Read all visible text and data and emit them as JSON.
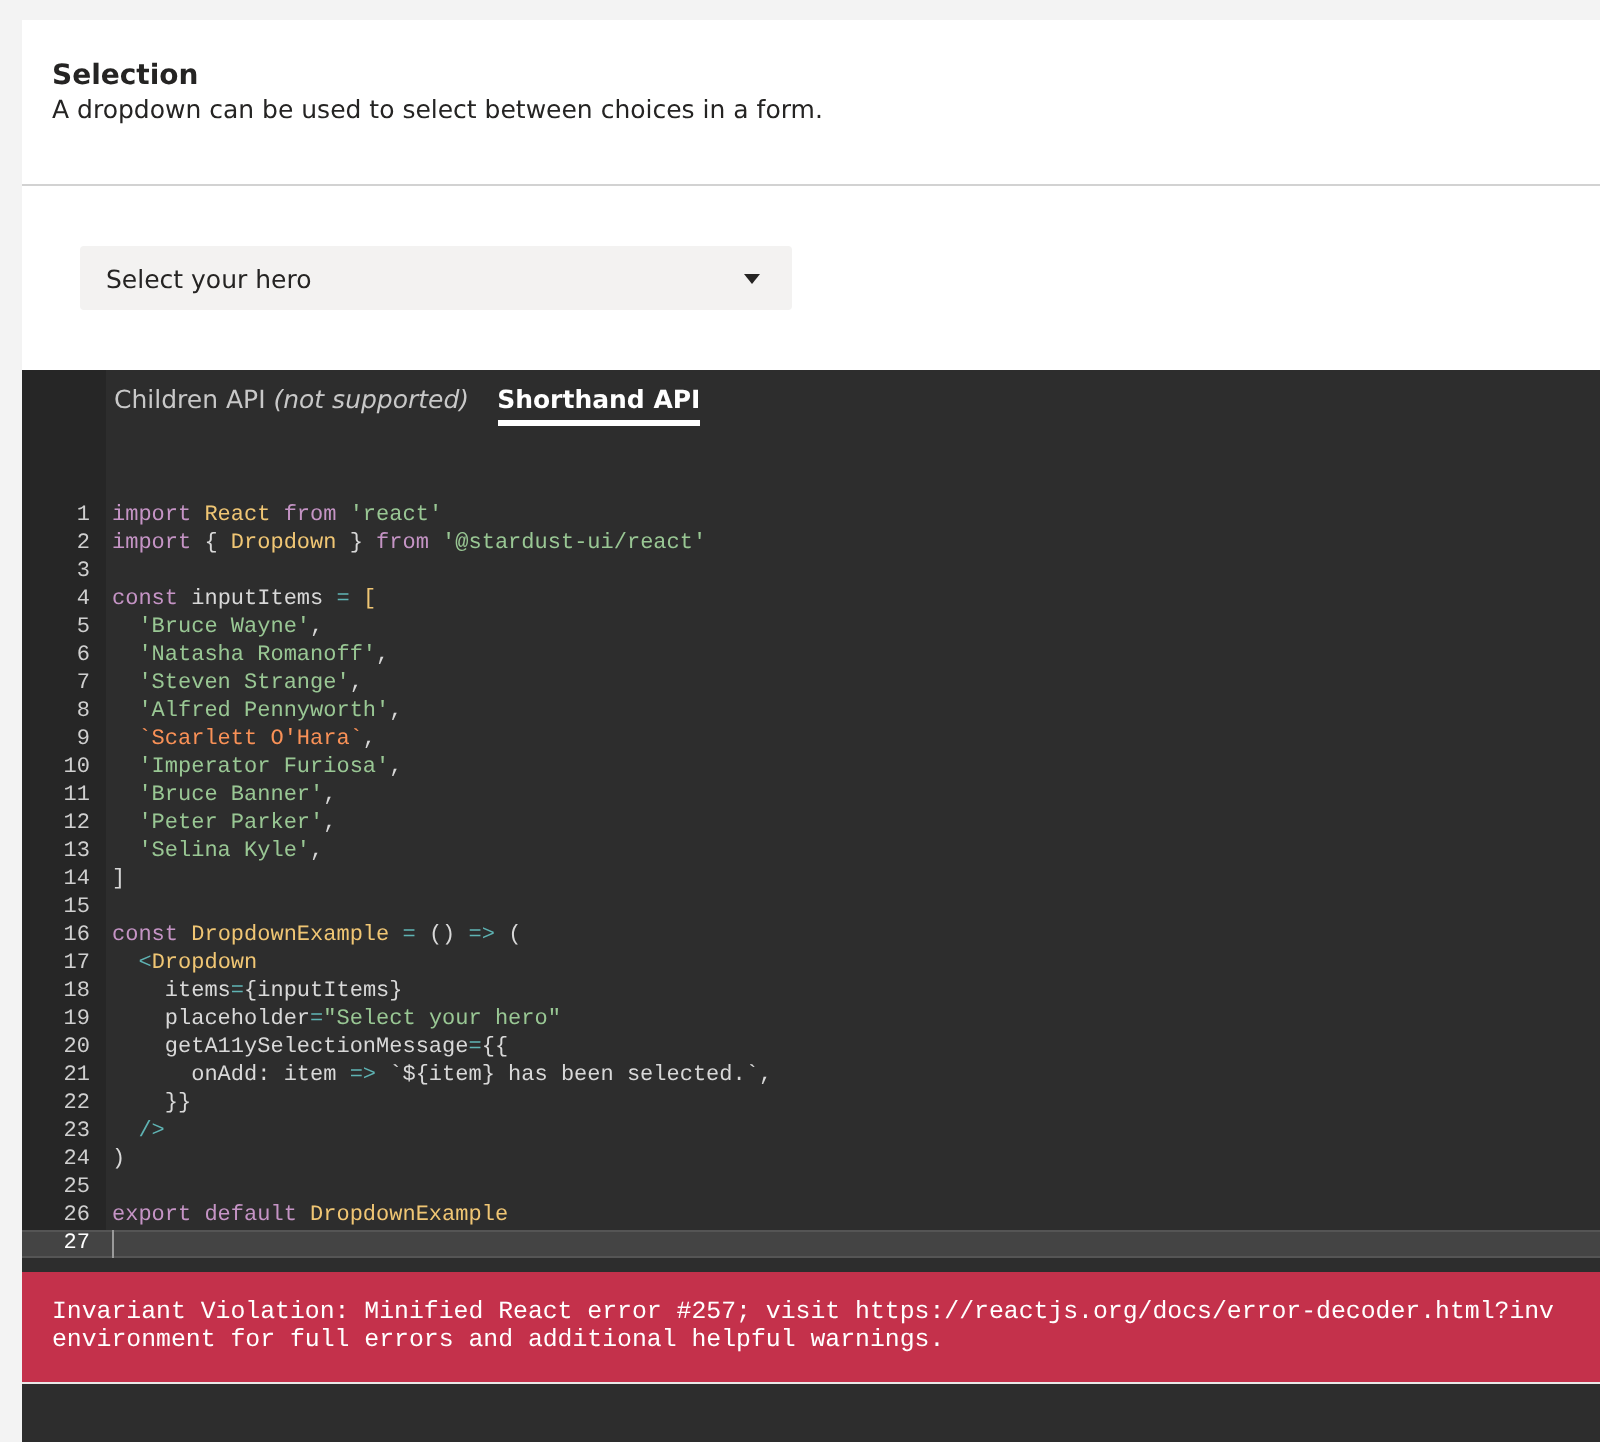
{
  "header": {
    "title": "Selection",
    "description": "A dropdown can be used to select between choices in a form."
  },
  "dropdown": {
    "placeholder": "Select your hero"
  },
  "tabs": [
    {
      "label": "Children API *(not supported)*",
      "selected": false
    },
    {
      "label": "Shorthand API",
      "selected": true
    }
  ],
  "code": {
    "lines": [
      {
        "number": "1",
        "current": false,
        "tokens": [
          {
            "kind": "keyword",
            "text": "import"
          },
          {
            "kind": "name",
            "text": " React"
          },
          {
            "kind": "keyword",
            "text": " from"
          },
          {
            "kind": "string",
            "text": " 'react'"
          }
        ]
      },
      {
        "number": "2",
        "current": false,
        "tokens": [
          {
            "kind": "keyword",
            "text": "import"
          },
          {
            "kind": "plain",
            "text": " { "
          },
          {
            "kind": "name",
            "text": "Dropdown"
          },
          {
            "kind": "plain",
            "text": " } "
          },
          {
            "kind": "keyword",
            "text": "from"
          },
          {
            "kind": "string",
            "text": " '@stardust-ui/react'"
          }
        ]
      },
      {
        "number": "3",
        "current": false
      },
      {
        "number": "4",
        "current": false,
        "tokens": [
          {
            "kind": "keyword",
            "text": "const"
          },
          {
            "kind": "plain",
            "text": " inputItems "
          },
          {
            "kind": "punct",
            "text": "="
          },
          {
            "kind": "name",
            "text": " ["
          }
        ]
      },
      {
        "number": "5",
        "current": false,
        "tokens": [
          {
            "kind": "string",
            "text": "  'Bruce Wayne'"
          },
          {
            "kind": "plain",
            "text": ","
          }
        ]
      },
      {
        "number": "6",
        "current": false,
        "tokens": [
          {
            "kind": "string",
            "text": "  'Natasha Romanoff'"
          },
          {
            "kind": "plain",
            "text": ","
          }
        ]
      },
      {
        "number": "7",
        "current": false,
        "tokens": [
          {
            "kind": "string",
            "text": "  'Steven Strange'"
          },
          {
            "kind": "plain",
            "text": ","
          }
        ]
      },
      {
        "number": "8",
        "current": false,
        "tokens": [
          {
            "kind": "string",
            "text": "  'Alfred Pennyworth'"
          },
          {
            "kind": "plain",
            "text": ","
          }
        ]
      },
      {
        "number": "9",
        "current": false,
        "tokens": [
          {
            "kind": "template",
            "text": "  `Scarlett O'Hara`"
          },
          {
            "kind": "plain",
            "text": ","
          }
        ]
      },
      {
        "number": "10",
        "current": false,
        "tokens": [
          {
            "kind": "string",
            "text": "  'Imperator Furiosa'"
          },
          {
            "kind": "plain",
            "text": ","
          }
        ]
      },
      {
        "number": "11",
        "current": false,
        "tokens": [
          {
            "kind": "string",
            "text": "  'Bruce Banner'"
          },
          {
            "kind": "plain",
            "text": ","
          }
        ]
      },
      {
        "number": "12",
        "current": false,
        "tokens": [
          {
            "kind": "string",
            "text": "  'Peter Parker'"
          },
          {
            "kind": "plain",
            "text": ","
          }
        ]
      },
      {
        "number": "13",
        "current": false,
        "tokens": [
          {
            "kind": "string",
            "text": "  'Selina Kyle'"
          },
          {
            "kind": "plain",
            "text": ","
          }
        ]
      },
      {
        "number": "14",
        "current": false,
        "tokens": [
          {
            "kind": "plain",
            "text": "]"
          }
        ]
      },
      {
        "number": "15",
        "current": false
      },
      {
        "number": "16",
        "current": false,
        "tokens": [
          {
            "kind": "keyword",
            "text": "const"
          },
          {
            "kind": "name",
            "text": " DropdownExample"
          },
          {
            "kind": "punct",
            "text": " ="
          },
          {
            "kind": "plain",
            "text": " ()"
          },
          {
            "kind": "punct",
            "text": " =>"
          },
          {
            "kind": "plain",
            "text": " ("
          }
        ]
      },
      {
        "number": "17",
        "current": false,
        "tokens": [
          {
            "kind": "punct",
            "text": "  <"
          },
          {
            "kind": "name",
            "text": "Dropdown"
          }
        ]
      },
      {
        "number": "18",
        "current": false,
        "tokens": [
          {
            "kind": "plain",
            "text": "    items"
          },
          {
            "kind": "punct",
            "text": "="
          },
          {
            "kind": "plain",
            "text": "{inputItems}"
          }
        ]
      },
      {
        "number": "19",
        "current": false,
        "tokens": [
          {
            "kind": "plain",
            "text": "    placeholder"
          },
          {
            "kind": "punct",
            "text": "="
          },
          {
            "kind": "string",
            "text": "\"Select your hero\""
          }
        ]
      },
      {
        "number": "20",
        "current": false,
        "tokens": [
          {
            "kind": "plain",
            "text": "    getA11ySelectionMessage"
          },
          {
            "kind": "punct",
            "text": "="
          },
          {
            "kind": "plain",
            "text": "{{"
          }
        ]
      },
      {
        "number": "21",
        "current": false,
        "tokens": [
          {
            "kind": "plain",
            "text": "      onAdd: item "
          },
          {
            "kind": "punct",
            "text": "=>"
          },
          {
            "kind": "plain",
            "text": " `${item} has been selected.`,"
          }
        ]
      },
      {
        "number": "22",
        "current": false,
        "tokens": [
          {
            "kind": "plain",
            "text": "    }}"
          }
        ]
      },
      {
        "number": "23",
        "current": false,
        "tokens": [
          {
            "kind": "punct",
            "text": "  />"
          }
        ]
      },
      {
        "number": "24",
        "current": false,
        "tokens": [
          {
            "kind": "plain",
            "text": ")"
          }
        ]
      },
      {
        "number": "25",
        "current": false
      },
      {
        "number": "26",
        "current": false,
        "tokens": [
          {
            "kind": "keyword",
            "text": "export default"
          },
          {
            "kind": "name",
            "text": " DropdownExample"
          }
        ]
      },
      {
        "number": "27",
        "current": true
      }
    ]
  },
  "error": {
    "lines": [
      "Invariant Violation: Minified React error #257; visit https://reactjs.org/docs/error-decoder.html?inv",
      "environment for full errors and additional helpful warnings."
    ]
  }
}
